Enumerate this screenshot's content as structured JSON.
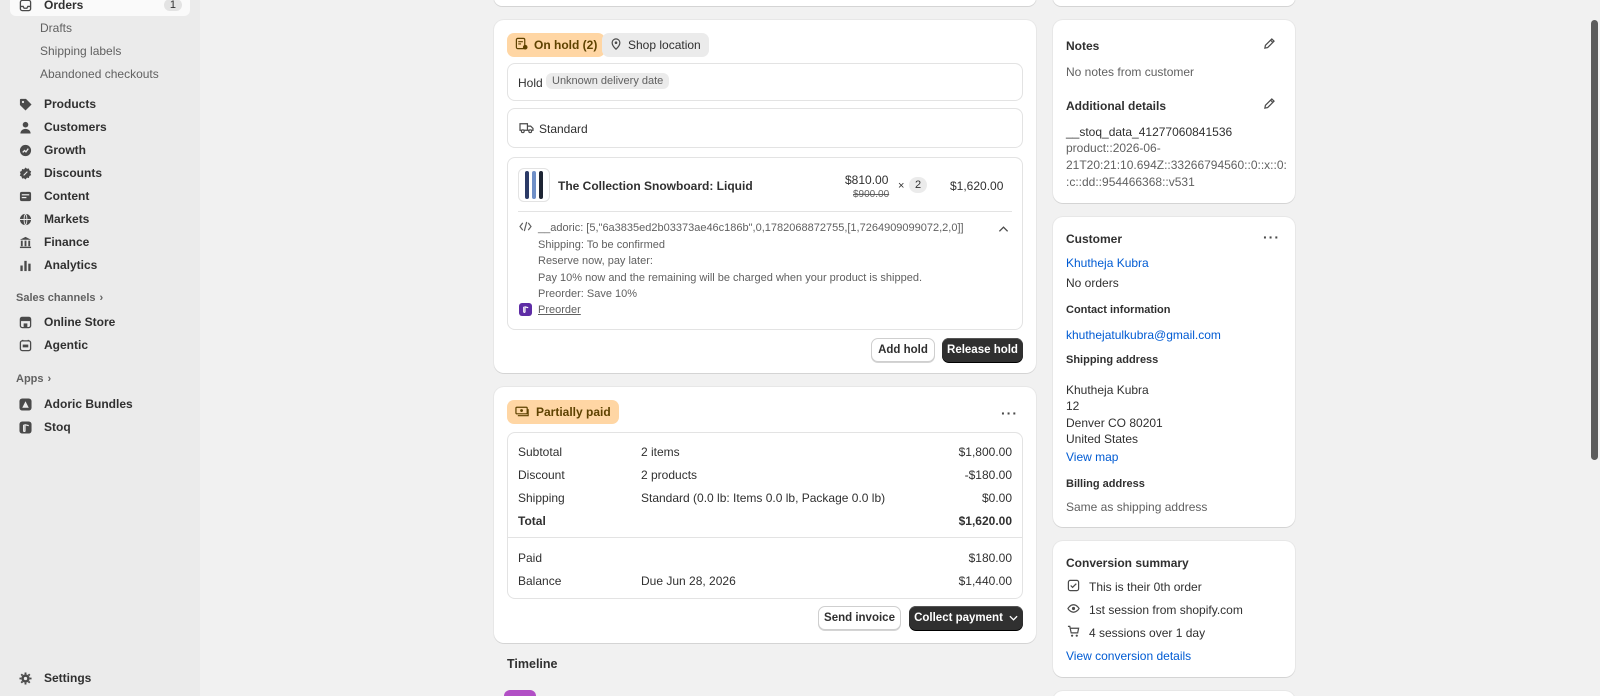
{
  "sidebar": {
    "orders": {
      "label": "Orders",
      "badge": "1"
    },
    "order_subs": [
      "Drafts",
      "Shipping labels",
      "Abandoned checkouts"
    ],
    "items": [
      {
        "label": "Products",
        "icon": "tag-icon"
      },
      {
        "label": "Customers",
        "icon": "person-icon"
      },
      {
        "label": "Growth",
        "icon": "growth-icon"
      },
      {
        "label": "Discounts",
        "icon": "discount-icon"
      },
      {
        "label": "Content",
        "icon": "content-icon"
      },
      {
        "label": "Markets",
        "icon": "globe-icon"
      },
      {
        "label": "Finance",
        "icon": "bank-icon"
      },
      {
        "label": "Analytics",
        "icon": "bar-chart-icon"
      }
    ],
    "sales_channels_label": "Sales channels",
    "channels": [
      {
        "label": "Online Store",
        "icon": "store-icon"
      },
      {
        "label": "Agentic",
        "icon": "agentic-icon"
      }
    ],
    "apps_label": "Apps",
    "apps": [
      {
        "label": "Adoric Bundles",
        "icon": "adoric-icon"
      },
      {
        "label": "Stoq",
        "icon": "stoq-icon"
      }
    ],
    "settings": "Settings"
  },
  "hold_card": {
    "status_badge": "On hold (2)",
    "location_badge": "Shop location",
    "hold_label": "Hold",
    "hold_tag": "Unknown delivery date",
    "shipping_method": "Standard",
    "product": {
      "name": "The Collection Snowboard: Liquid",
      "price": "$810.00",
      "original_price": "$900.00",
      "times": "×",
      "quantity": "2",
      "total": "$1,620.00"
    },
    "property_key": "__adoric: [5,\"6a3835ed2b03373ae46c186b\",0,1782068872755,[1,7264909099072,2,0]]",
    "property_lines": [
      "Shipping: To be confirmed",
      "Reserve now, pay later:",
      "Pay 10% now and the remaining will be charged when your product is shipped.",
      "Preorder: Save 10%"
    ],
    "preorder_link": "Preorder",
    "add_hold": "Add hold",
    "release_hold": "Release hold"
  },
  "payment_card": {
    "status_badge": "Partially paid",
    "rows": [
      {
        "label": "Subtotal",
        "desc": "2 items",
        "amount": "$1,800.00"
      },
      {
        "label": "Discount",
        "desc": "2 products",
        "amount": "-$180.00"
      },
      {
        "label": "Shipping",
        "desc": "Standard (0.0 lb: Items 0.0 lb, Package 0.0 lb)",
        "amount": "$0.00"
      },
      {
        "label": "Total",
        "desc": "",
        "amount": "$1,620.00"
      }
    ],
    "paid_label": "Paid",
    "paid_amount": "$180.00",
    "balance_label": "Balance",
    "balance_desc": "Due Jun 28, 2026",
    "balance_amount": "$1,440.00",
    "send_invoice": "Send invoice",
    "collect_payment": "Collect payment"
  },
  "timeline_title": "Timeline",
  "notes_card": {
    "title": "Notes",
    "text": "No notes from customer",
    "additional_title": "Additional details",
    "additional_key": "__stoq_data_41277060841536",
    "additional_value_lines": [
      "product::2026-06-",
      "21T20:21:10.694Z::33266794560::0::x::0:",
      ":c::dd::954466368::v531"
    ]
  },
  "customer_card": {
    "title": "Customer",
    "name": "Khutheja Kubra",
    "orders": "No orders",
    "contact_title": "Contact information",
    "email": "khuthejatulkubra@gmail.com",
    "shipping_title": "Shipping address",
    "address_lines": [
      "Khutheja Kubra",
      "12",
      "Denver CO 80201",
      "United States"
    ],
    "view_map": "View map",
    "billing_title": "Billing address",
    "billing_text": "Same as shipping address"
  },
  "conversion_card": {
    "title": "Conversion summary",
    "items": [
      {
        "text": "This is their 0th order",
        "icon": "order-icon"
      },
      {
        "text": "1st session from shopify.com",
        "icon": "eye-icon"
      },
      {
        "text": "4 sessions over 1 day",
        "icon": "cart-icon"
      }
    ],
    "link": "View conversion details"
  },
  "colors": {
    "on_hold_bg": "#ffd6a4",
    "partially_paid_bg": "#ffd6a4",
    "link": "#005bd3",
    "primary_button": "#303030",
    "app_purple": "#5e2ca5"
  }
}
